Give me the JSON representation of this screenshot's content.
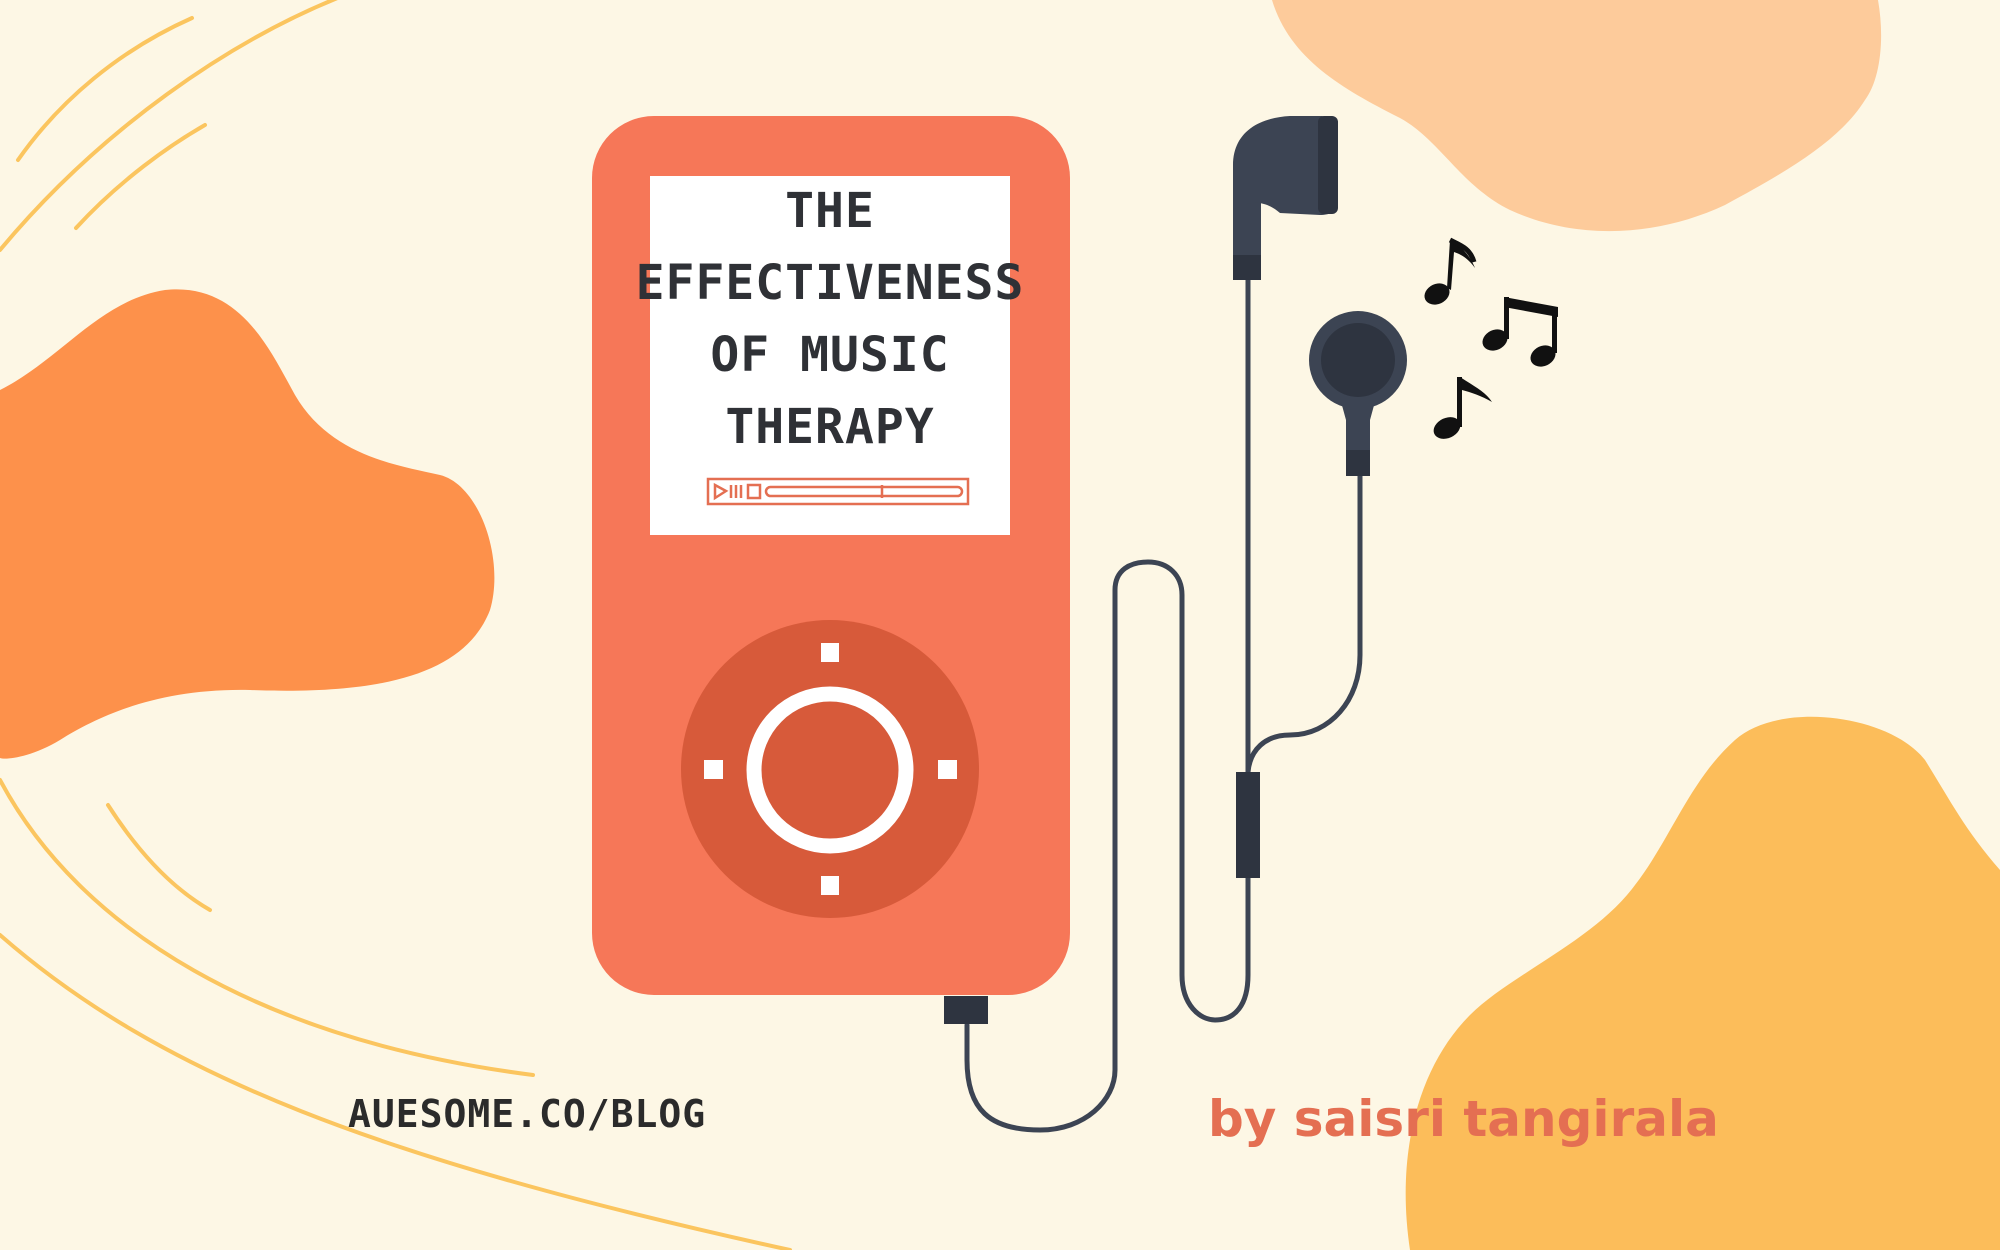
{
  "screen": {
    "title_lines": [
      "THE",
      "EFFECTIVENESS",
      "OF MUSIC",
      "THERAPY"
    ]
  },
  "footer": {
    "site_url": "AUESOME.CO/BLOG",
    "author": "by saisri tangirala"
  },
  "colors": {
    "background": "#fdf7e5",
    "player_body": "#f67758",
    "wheel_dark": "#d75a3a",
    "blob_orange": "#fd914b",
    "blob_peach": "#fdcb9b",
    "blob_yellow": "#fcbd5a",
    "swirl_lines": "#fbc55f",
    "earphones": "#3c4453",
    "author_text": "#e46f52"
  },
  "icons": [
    "play-pause-icon",
    "stop-icon",
    "music-note-icon"
  ]
}
